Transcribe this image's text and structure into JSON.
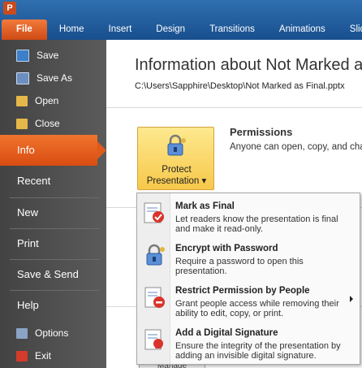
{
  "ribbon": {
    "tabs": [
      "File",
      "Home",
      "Insert",
      "Design",
      "Transitions",
      "Animations",
      "Slide"
    ]
  },
  "sidebar": {
    "commands_top": [
      {
        "label": "Save",
        "icon": "save-icon",
        "color": "#3d7fc9"
      },
      {
        "label": "Save As",
        "icon": "save-as-icon",
        "color": "#6b8fc0"
      },
      {
        "label": "Open",
        "icon": "open-folder-icon",
        "color": "#e6b84a"
      },
      {
        "label": "Close",
        "icon": "close-folder-icon",
        "color": "#e6b84a"
      }
    ],
    "nav": [
      "Info",
      "Recent",
      "New",
      "Print",
      "Save & Send",
      "Help"
    ],
    "commands_bottom": [
      {
        "label": "Options",
        "icon": "options-icon",
        "color": "#8aa3c6"
      },
      {
        "label": "Exit",
        "icon": "exit-icon",
        "color": "#d43b2b"
      }
    ]
  },
  "main": {
    "title": "Information about Not Marked as Final",
    "path": "C:\\Users\\Sapphire\\Desktop\\Not Marked as Final.pptx",
    "protect": {
      "line1": "Protect",
      "line2": "Presentation"
    },
    "permissions": {
      "title": "Permissions",
      "description": "Anyone can open, copy, and change any part of this presentation."
    },
    "manage_label": "Manage"
  },
  "menu": {
    "items": [
      {
        "title": "Mark as Final",
        "desc": "Let readers know the presentation is final and make it read-only.",
        "icon": "mark-final-icon"
      },
      {
        "title": "Encrypt with Password",
        "desc": "Require a password to open this presentation.",
        "icon": "encrypt-lock-icon"
      },
      {
        "title": "Restrict Permission by People",
        "desc": "Grant people access while removing their ability to edit, copy, or print.",
        "icon": "restrict-permission-icon"
      },
      {
        "title": "Add a Digital Signature",
        "desc": "Ensure the integrity of the presentation by adding an invisible digital signature.",
        "icon": "digital-signature-icon"
      }
    ]
  },
  "colors": {
    "ribbon": "#2a64a6",
    "file_tab": "#e35d1f",
    "sidebar": "#4d4d4d",
    "active_nav": "#e5601f",
    "protect_button": "#f9d467"
  }
}
